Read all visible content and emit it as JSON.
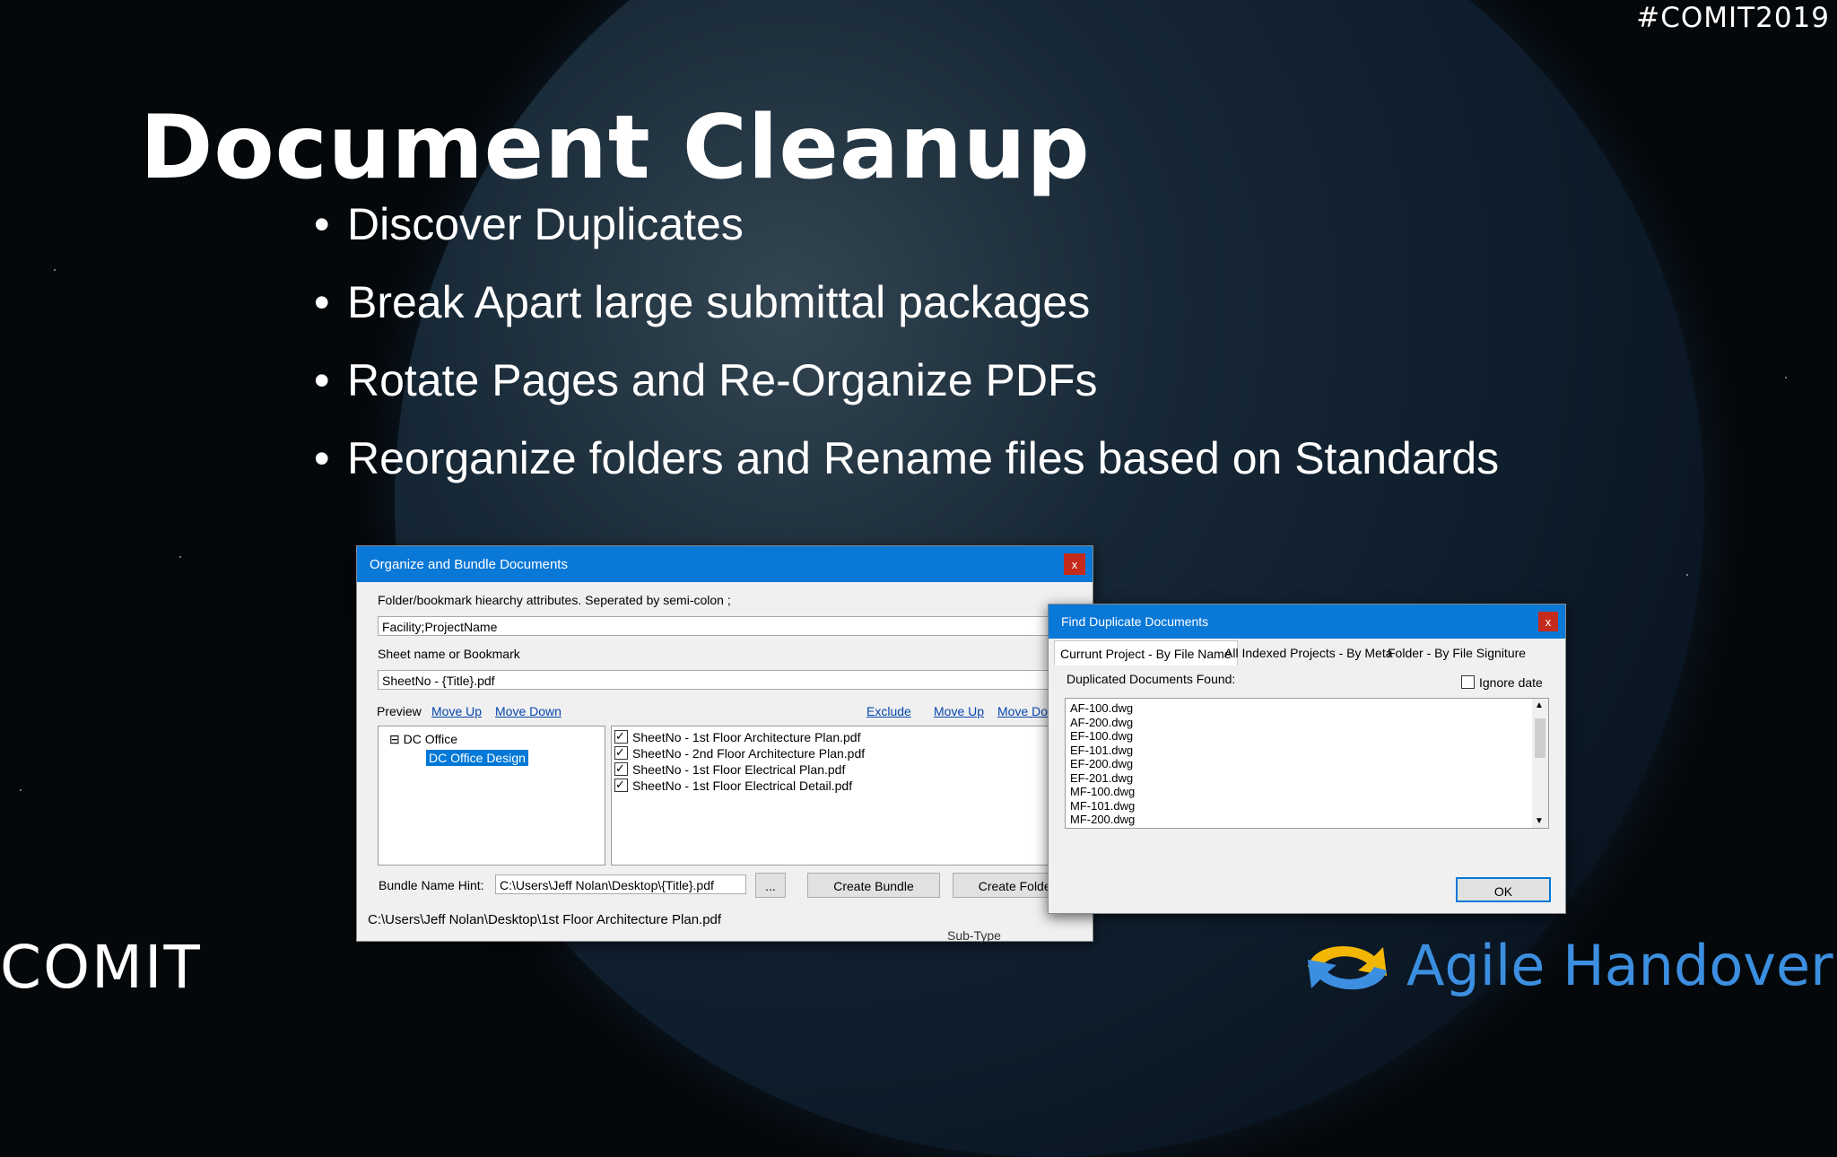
{
  "hashtag": "#COMIT2019",
  "slide": {
    "title": "Document Cleanup",
    "bullets": [
      "Discover Duplicates",
      "Break Apart large submittal packages",
      "Rotate Pages and Re-Organize PDFs",
      "Reorganize folders and Rename files based on Standards"
    ]
  },
  "organize_dialog": {
    "title": "Organize and Bundle Documents",
    "close": "x",
    "hierarchy_label": "Folder/bookmark hiearchy attributes. Seperated by semi-colon ;",
    "hierarchy_value": "Facility;ProjectName",
    "sheet_label": "Sheet name or Bookmark",
    "sheet_value": "SheetNo - {Title}.pdf",
    "preview_label": "Preview",
    "left_links": [
      "Move Up",
      "Move Down"
    ],
    "right_links": [
      "Exclude",
      "Move Up",
      "Move Do"
    ],
    "tree": {
      "root_toggle": "⊟",
      "root": "DC Office",
      "child": "DC Office Design"
    },
    "files": [
      "SheetNo - 1st Floor Architecture Plan.pdf",
      "SheetNo - 2nd Floor Architecture Plan.pdf",
      "SheetNo - 1st Floor Electrical Plan.pdf",
      "SheetNo - 1st Floor Electrical Detail.pdf"
    ],
    "bundle_label": "Bundle Name Hint:",
    "bundle_value": "C:\\Users\\Jeff Nolan\\Desktop\\{Title}.pdf",
    "browse": "...",
    "create_bundle": "Create Bundle",
    "create_folders": "Create Folders",
    "status_path": "C:\\Users\\Jeff Nolan\\Desktop\\1st Floor Architecture Plan.pdf",
    "background_text": "Sub-Type"
  },
  "duplicates_dialog": {
    "title": "Find Duplicate Documents",
    "close": "x",
    "tabs": [
      "Currunt Project - By File Name",
      "All Indexed Projects - By Meta",
      "Folder - By File Signiture"
    ],
    "found_label": "Duplicated Documents Found:",
    "ignore_date": "Ignore date",
    "files": [
      "AF-100.dwg",
      "AF-200.dwg",
      "EF-100.dwg",
      "EF-101.dwg",
      "EF-200.dwg",
      "EF-201.dwg",
      "MF-100.dwg",
      "MF-101.dwg",
      "MF-200.dwg"
    ],
    "ok": "OK"
  },
  "logos": {
    "comit": "COMIT",
    "agile": "Agile Handover"
  },
  "colors": {
    "titlebar": "#0a78d7",
    "agile": "#3c8fe0",
    "close": "#c42b1c"
  }
}
